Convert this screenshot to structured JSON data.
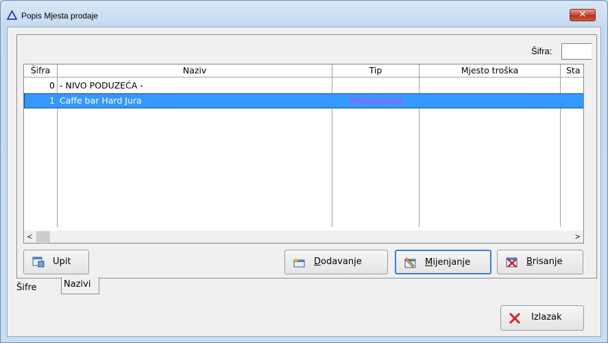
{
  "window": {
    "title": "Popis Mjesta prodaje",
    "close_glyph": "✕"
  },
  "filter": {
    "label": "Šifra:",
    "value": ""
  },
  "grid": {
    "columns": [
      "Šifra",
      "Naziv",
      "Tip",
      "Mjesto troška",
      "Sta"
    ],
    "rows": [
      {
        "sifra": "0",
        "naziv": "- NIVO PODUZEĆA -",
        "tip": "",
        "mjesto": "",
        "status": ""
      },
      {
        "sifra": "1",
        "naziv": "Caffe bar Hard Jura",
        "tip": "Maloprodaja",
        "mjesto": "",
        "status": "",
        "selected": true
      }
    ],
    "scroll_left": "<",
    "scroll_right": ">"
  },
  "buttons": {
    "upit": "Upit",
    "dodavanje_u": "D",
    "dodavanje_rest": "odavanje",
    "mijenjanje_u": "M",
    "mijenjanje_rest": "ijenjanje",
    "brisanje_u": "B",
    "brisanje_rest": "risanje",
    "izlazak": "Izlazak"
  },
  "tabs": {
    "sifre": "Šifre",
    "nazivi": "Nazivi"
  },
  "colors": {
    "selection": "#3399ff",
    "tip_text": "#d040e0",
    "accent": "#3a7fc5"
  },
  "icons": [
    "warning-triangle-icon",
    "close-icon",
    "query-icon",
    "add-icon",
    "edit-icon",
    "delete-icon",
    "exit-x-icon"
  ]
}
